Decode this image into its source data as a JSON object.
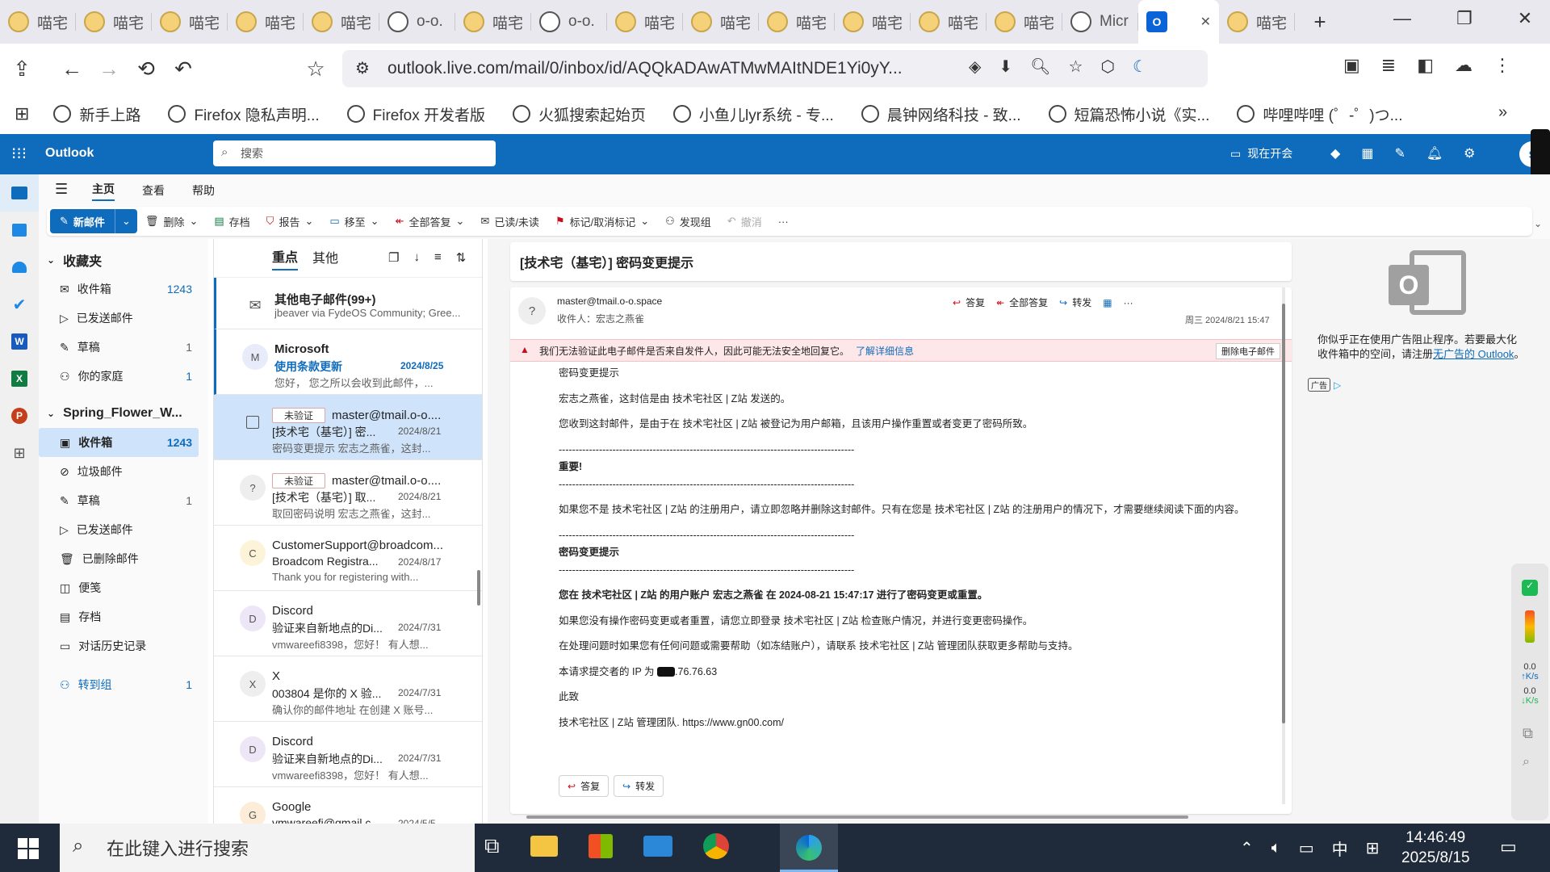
{
  "browser": {
    "tabs": [
      {
        "label": "喵宅",
        "icon": "cat-favicon"
      },
      {
        "label": "喵宅",
        "icon": "cat-favicon"
      },
      {
        "label": "喵宅",
        "icon": "cat-favicon"
      },
      {
        "label": "喵宅",
        "icon": "cat-favicon"
      },
      {
        "label": "喵宅",
        "icon": "cat-favicon"
      },
      {
        "label": "o-o.",
        "icon": "globe-favicon"
      },
      {
        "label": "喵宅",
        "icon": "cat-favicon"
      },
      {
        "label": "o-o.",
        "icon": "globe-favicon"
      },
      {
        "label": "喵宅",
        "icon": "cat-favicon"
      },
      {
        "label": "喵宅",
        "icon": "cat-favicon"
      },
      {
        "label": "喵宅",
        "icon": "cat-favicon"
      },
      {
        "label": "喵宅",
        "icon": "cat-favicon"
      },
      {
        "label": "喵宅",
        "icon": "cat-favicon"
      },
      {
        "label": "喵宅",
        "icon": "cat-favicon"
      },
      {
        "label": "Micr",
        "icon": "globe-favicon"
      },
      {
        "label": "",
        "icon": "outlook-favicon",
        "active": true
      },
      {
        "label": "喵宅",
        "icon": "cat-favicon"
      }
    ],
    "url": "outlook.live.com/mail/0/inbox/id/AQQkADAwATMwMAItNDE1Yi0yY...",
    "bookmarks": [
      "新手上路",
      "Firefox 隐私声明...",
      "Firefox 开发者版",
      "火狐搜索起始页",
      "小鱼儿lyr系统 - 专...",
      "晨钟网络科技 - 致...",
      "短篇恐怖小说《实...",
      "哔哩哔哩 (゜-゜)つ..."
    ]
  },
  "outlook": {
    "app_name": "Outlook",
    "search_placeholder": "搜索",
    "meet_now": "现在开会",
    "avatar": "S",
    "ribbon_tabs": [
      "主页",
      "查看",
      "帮助"
    ],
    "toolbar": {
      "new_mail": "新邮件",
      "delete": "删除",
      "archive": "存档",
      "report": "报告",
      "move": "移至",
      "reply_all": "全部答复",
      "read_unread": "已读/未读",
      "flag": "标记/取消标记",
      "discover": "发现组",
      "undo": "撤消",
      "more": "···"
    },
    "favorites": {
      "title": "收藏夹",
      "items": [
        {
          "label": "收件箱",
          "count": "1243"
        },
        {
          "label": "已发送邮件",
          "count": ""
        },
        {
          "label": "草稿",
          "count": "1"
        },
        {
          "label": "你的家庭",
          "count": "1"
        }
      ]
    },
    "account": {
      "title": "Spring_Flower_W...",
      "items": [
        {
          "label": "收件箱",
          "count": "1243"
        },
        {
          "label": "垃圾邮件",
          "count": ""
        },
        {
          "label": "草稿",
          "count": "1"
        },
        {
          "label": "已发送邮件",
          "count": ""
        },
        {
          "label": "已删除邮件",
          "count": ""
        },
        {
          "label": "便笺",
          "count": ""
        },
        {
          "label": "存档",
          "count": ""
        },
        {
          "label": "对话历史记录",
          "count": ""
        }
      ],
      "groups_label": "转到组",
      "groups_count": "1"
    },
    "list_tabs": {
      "focused": "重点",
      "other": "其他"
    },
    "messages": [
      {
        "avatar": "",
        "from": "其他电子邮件(99+)",
        "subject": "",
        "date": "",
        "preview": "jbeaver via FydeOS Community; Gree..."
      },
      {
        "avatar": "M",
        "from": "Microsoft",
        "subject": "使用条款更新",
        "date": "2024/8/25",
        "preview": "您好， 您之所以会收到此邮件，..."
      },
      {
        "avatar": "",
        "tag": "未验证",
        "from": "master@tmail.o-o....",
        "subject": "[技术宅（基宅）] 密...",
        "date": "2024/8/21",
        "preview": "密码变更提示 宏志之燕雀，这封..."
      },
      {
        "avatar": "?",
        "tag": "未验证",
        "from": "master@tmail.o-o....",
        "subject": "[技术宅（基宅）] 取...",
        "date": "2024/8/21",
        "preview": "取回密码说明 宏志之燕雀，这封..."
      },
      {
        "avatar": "C",
        "from": "CustomerSupport@broadcom...",
        "subject": "Broadcom Registra...",
        "date": "2024/8/17",
        "preview": "Thank you for registering with..."
      },
      {
        "avatar": "D",
        "from": "Discord",
        "subject": "验证来自新地点的Di...",
        "date": "2024/7/31",
        "preview": "vmwareefi8398，您好！ 有人想..."
      },
      {
        "avatar": "X",
        "from": "X",
        "subject": "003804 是你的 X 验...",
        "date": "2024/7/31",
        "preview": "确认你的邮件地址 在创建 X 账号..."
      },
      {
        "avatar": "D",
        "from": "Discord",
        "subject": "验证来自新地点的Di...",
        "date": "2024/7/31",
        "preview": "vmwareefi8398，您好！ 有人想..."
      },
      {
        "avatar": "G",
        "from": "Google",
        "subject": "vmwareefi@gmail.c...",
        "date": "2024/5/5",
        "preview": ""
      }
    ],
    "reading": {
      "subject": "[技术宅（基宅）] 密码变更提示",
      "sender_avatar": "?",
      "from": "master@tmail.o-o.space",
      "to_label": "收件人：",
      "to": "宏志之燕雀",
      "date": "周三 2024/8/21 15:47",
      "reply": "答复",
      "reply_all": "全部答复",
      "forward": "转发",
      "warning": "我们无法验证此电子邮件是否来自发件人，因此可能无法安全地回复它。",
      "warning_link": "了解详细信息",
      "delete_mail": "删除电子邮件",
      "body": {
        "line1": "密码变更提示",
        "line2": "宏志之燕雀，这封信是由 技术宅社区 | Z站 发送的。",
        "line3": "您收到这封邮件，是由于在 技术宅社区 | Z站 被登记为用户邮箱，且该用户操作重置或者变更了密码所致。",
        "dashes": "----------------------------------------------------------------------------------------",
        "important": "重要!",
        "line4": "如果您不是 技术宅社区 | Z站 的注册用户，请立即忽略并删除这封邮件。只有在您是 技术宅社区 | Z站 的注册用户的情况下，才需要继续阅读下面的内容。",
        "section": "密码变更提示",
        "bold_line": "您在 技术宅社区 | Z站 的用户账户 宏志之燕雀 在 2024-08-21 15:47:17 进行了密码变更或重置。",
        "line5": "如果您没有操作密码变更或者重置，请您立即登录 技术宅社区 | Z站 检查账户情况，并进行变更密码操作。",
        "line6": "在处理问题时如果您有任何问题或需要帮助（如冻结账户），请联系 技术宅社区 | Z站 管理团队获取更多帮助与支持。",
        "ip_label": "本请求提交者的 IP 为",
        "ip_suffix": ".76.76.63",
        "closing": "此致",
        "signature": "技术宅社区 | Z站 管理团队. https://www.gn00.com/"
      },
      "btn_reply": "答复",
      "btn_forward": "转发"
    },
    "ad": {
      "text": "你似乎正在使用广告阻止程序。若要最大化收件箱中的空间，请注册",
      "link": "无广告的 Outlook",
      "period": "。",
      "badge": "广告"
    },
    "net_monitor": {
      "up": "0.0",
      "up_unit": "K/s",
      "down": "0.0",
      "down_unit": "K/s"
    }
  },
  "taskbar": {
    "search_placeholder": "在此键入进行搜索",
    "ime": "中",
    "time": "14:46:49",
    "date": "2025/8/15"
  },
  "colors": {
    "accent": "#0f6cbd",
    "selected": "#cfe4fa",
    "warning": "#fde7e9"
  }
}
